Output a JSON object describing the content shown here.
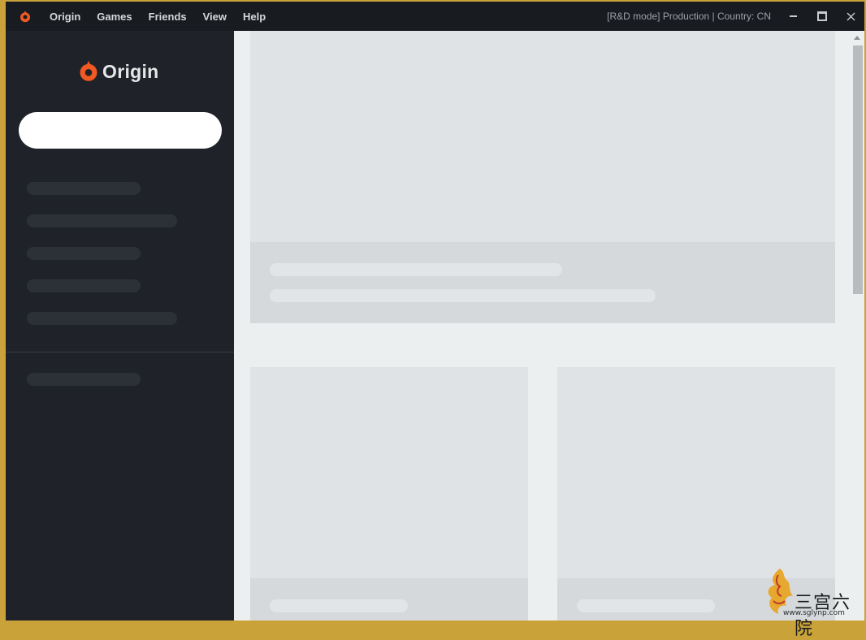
{
  "titlebar": {
    "menu": [
      "Origin",
      "Games",
      "Friends",
      "View",
      "Help"
    ],
    "status": "[R&D mode] Production | Country: CN"
  },
  "sidebar": {
    "brand": "Origin"
  },
  "watermark": {
    "text": "三宫六院",
    "url": "www.sglynp.com"
  },
  "colors": {
    "accent": "#f05a22",
    "sidebar_bg": "#1f2329",
    "titlebar_bg": "#181b20",
    "content_bg": "#eceff0"
  }
}
